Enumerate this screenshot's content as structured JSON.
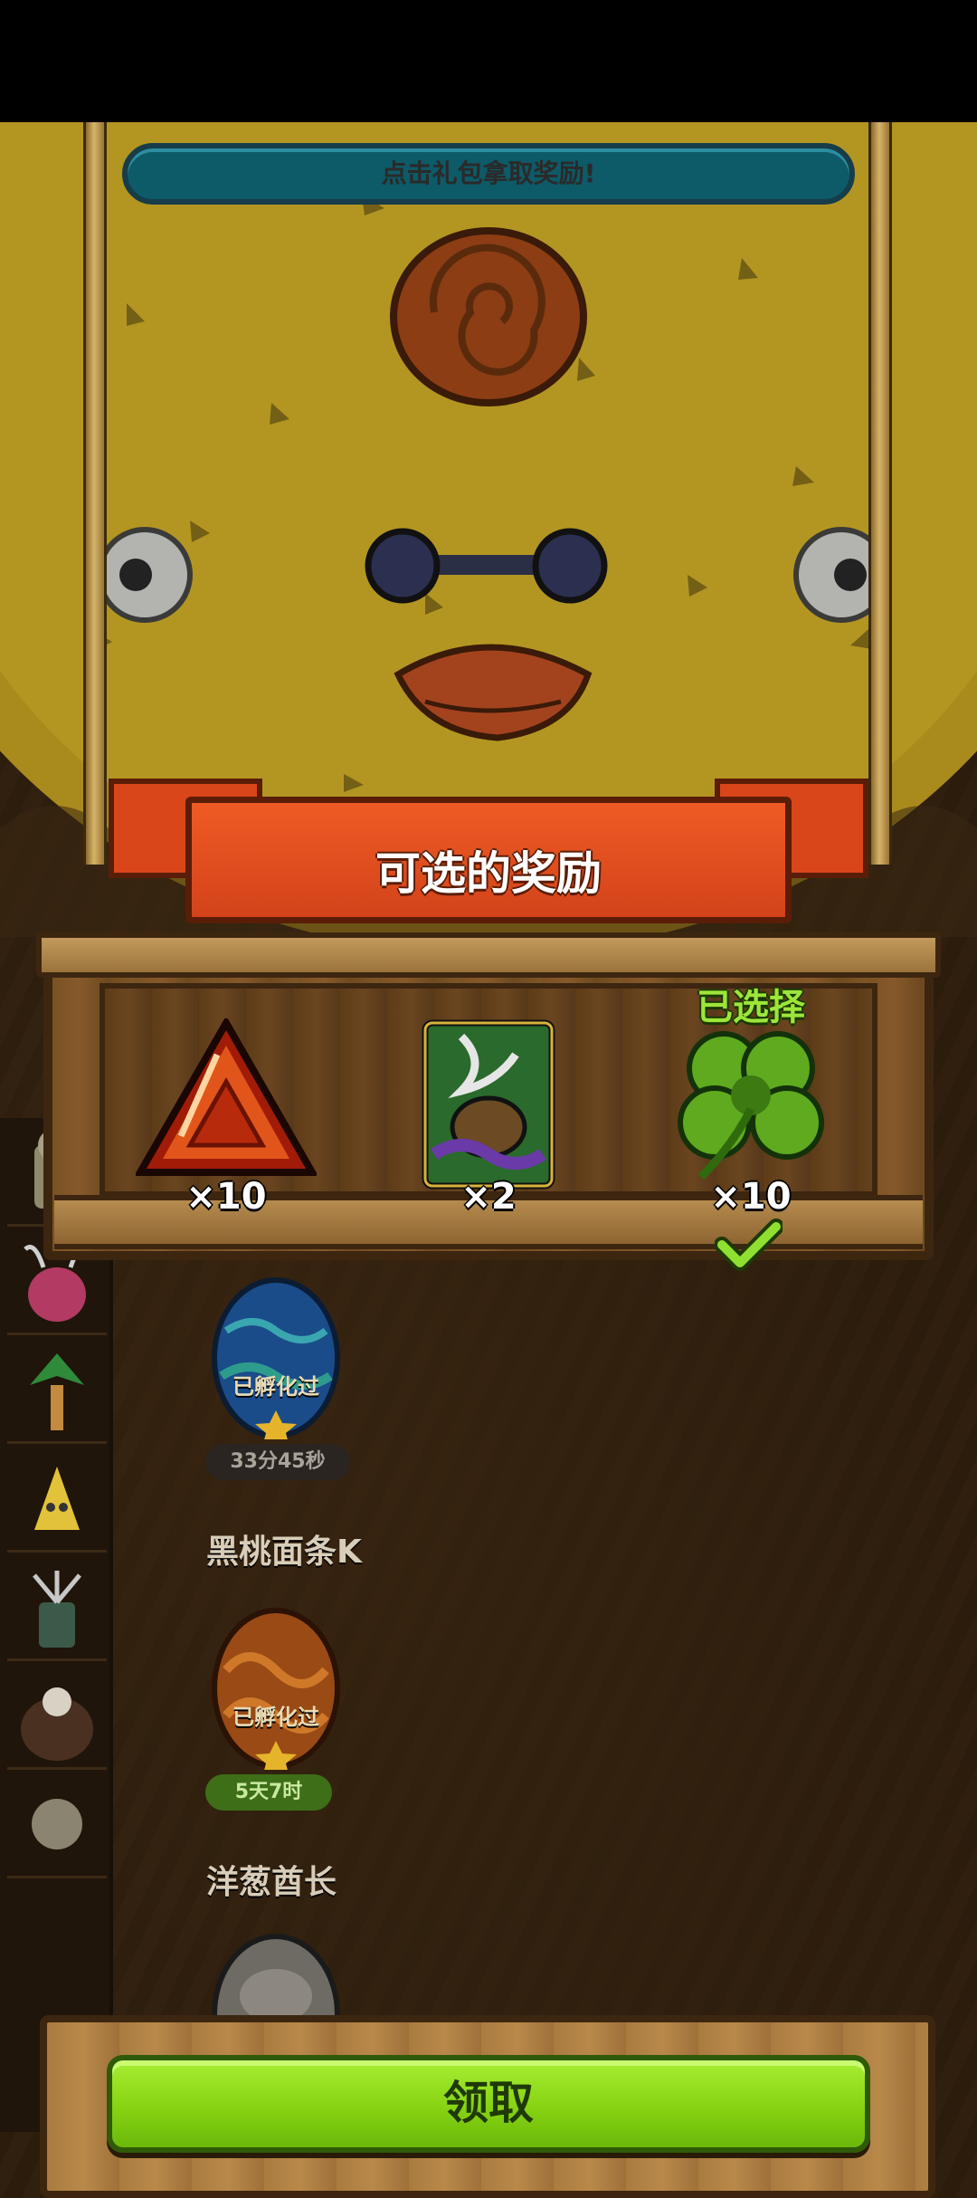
{
  "hint_bar": {
    "text": "点击礼包拿取奖励!"
  },
  "panel": {
    "title": "可选的奖励",
    "selected_label": "已选择",
    "rewards": [
      {
        "name": "red-crystal-icon",
        "qty": "×10"
      },
      {
        "name": "spell-card-icon",
        "qty": "×2"
      },
      {
        "name": "four-leaf-clover-icon",
        "qty": "×10",
        "selected": true
      }
    ]
  },
  "list": {
    "eggs": [
      {
        "label": "已孵化过",
        "timer": "33分45秒"
      },
      {
        "label": "已孵化过",
        "timer": "5天7时"
      }
    ],
    "names": [
      "黑桃面条K",
      "洋葱酋长"
    ]
  },
  "claim_button": {
    "label": "领取"
  }
}
